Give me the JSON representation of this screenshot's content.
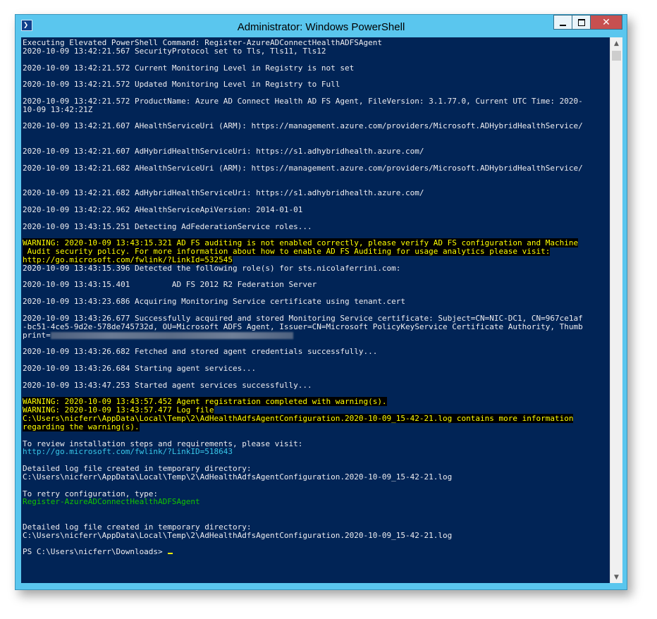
{
  "window": {
    "title": "Administrator: Windows PowerShell",
    "icon": "powershell-icon",
    "icon_glyph": "❯",
    "controls": {
      "minimize": "minimize-icon",
      "maximize": "maximize-icon",
      "close_glyph": "✕"
    }
  },
  "colors": {
    "console_bg": "#012456",
    "text": "#eeedf0",
    "warning_fg": "#ffff00",
    "warning_bg": "#000000",
    "link": "#38c7e8",
    "command": "#13c400"
  },
  "console": {
    "lines": [
      {
        "text": "Executing Elevated PowerShell Command: Register-AzureADConnectHealthADFSAgent",
        "style": "normal"
      },
      {
        "text": "2020-10-09 13:42:21.567 SecurityProtocol set to Tls, Tls11, Tls12",
        "style": "normal"
      },
      {
        "text": "",
        "style": "normal"
      },
      {
        "text": "2020-10-09 13:42:21.572 Current Monitoring Level in Registry is not set",
        "style": "normal"
      },
      {
        "text": "",
        "style": "normal"
      },
      {
        "text": "2020-10-09 13:42:21.572 Updated Monitoring Level in Registry to Full",
        "style": "normal"
      },
      {
        "text": "",
        "style": "normal"
      },
      {
        "text": "2020-10-09 13:42:21.572 ProductName: Azure AD Connect Health AD FS Agent, FileVersion: 3.1.77.0, Current UTC Time: 2020-",
        "style": "normal"
      },
      {
        "text": "10-09 13:42:21Z",
        "style": "normal"
      },
      {
        "text": "",
        "style": "normal"
      },
      {
        "text": "2020-10-09 13:42:21.607 AHealthServiceUri (ARM): https://management.azure.com/providers/Microsoft.ADHybridHealthService/",
        "style": "normal"
      },
      {
        "text": "",
        "style": "normal"
      },
      {
        "text": "",
        "style": "normal"
      },
      {
        "text": "2020-10-09 13:42:21.607 AdHybridHealthServiceUri: https://s1.adhybridhealth.azure.com/",
        "style": "normal"
      },
      {
        "text": "",
        "style": "normal"
      },
      {
        "text": "2020-10-09 13:42:21.682 AHealthServiceUri (ARM): https://management.azure.com/providers/Microsoft.ADHybridHealthService/",
        "style": "normal"
      },
      {
        "text": "",
        "style": "normal"
      },
      {
        "text": "",
        "style": "normal"
      },
      {
        "text": "2020-10-09 13:42:21.682 AdHybridHealthServiceUri: https://s1.adhybridhealth.azure.com/",
        "style": "normal"
      },
      {
        "text": "",
        "style": "normal"
      },
      {
        "text": "2020-10-09 13:42:22.962 AHealthServiceApiVersion: 2014-01-01",
        "style": "normal"
      },
      {
        "text": "",
        "style": "normal"
      },
      {
        "text": "2020-10-09 13:43:15.251 Detecting AdFederationService roles...",
        "style": "normal"
      },
      {
        "text": "",
        "style": "normal"
      },
      {
        "text": "WARNING: 2020-10-09 13:43:15.321 AD FS auditing is not enabled correctly, please verify AD FS configuration and Machine",
        "style": "warn"
      },
      {
        "text": " Audit security policy. For more information about how to enable AD FS Auditing for usage analytics please visit:",
        "style": "warn"
      },
      {
        "text": "http://go.microsoft.com/fwlink/?LinkId=532545",
        "style": "warn"
      },
      {
        "text": "2020-10-09 13:43:15.396 Detected the following role(s) for sts.nicolaferrini.com:",
        "style": "normal"
      },
      {
        "text": "",
        "style": "normal"
      },
      {
        "text": "2020-10-09 13:43:15.401         AD FS 2012 R2 Federation Server",
        "style": "normal"
      },
      {
        "text": "",
        "style": "normal"
      },
      {
        "text": "2020-10-09 13:43:23.686 Acquiring Monitoring Service certificate using tenant.cert",
        "style": "normal"
      },
      {
        "text": "",
        "style": "normal"
      },
      {
        "text": "2020-10-09 13:43:26.677 Successfully acquired and stored Monitoring Service certificate: Subject=CN=NIC-DC1, CN=967ce1af",
        "style": "normal"
      },
      {
        "text": "-bc51-4ce5-9d2e-578de745732d, OU=Microsoft ADFS Agent, Issuer=CN=Microsoft PolicyKeyService Certificate Authority, Thumb",
        "style": "normal"
      },
      {
        "text": "print=",
        "style": "blurred",
        "blur_width": "52ch"
      },
      {
        "text": "",
        "style": "normal"
      },
      {
        "text": "2020-10-09 13:43:26.682 Fetched and stored agent credentials successfully...",
        "style": "normal"
      },
      {
        "text": "",
        "style": "normal"
      },
      {
        "text": "2020-10-09 13:43:26.684 Starting agent services...",
        "style": "normal"
      },
      {
        "text": "",
        "style": "normal"
      },
      {
        "text": "2020-10-09 13:43:47.253 Started agent services successfully...",
        "style": "normal"
      },
      {
        "text": "",
        "style": "normal"
      },
      {
        "text": "WARNING: 2020-10-09 13:43:57.452 Agent registration completed with warning(s).",
        "style": "warn"
      },
      {
        "text": "WARNING: 2020-10-09 13:43:57.477 Log file",
        "style": "warn"
      },
      {
        "text": "C:\\Users\\nicferr\\AppData\\Local\\Temp\\2\\AdHealthAdfsAgentConfiguration.2020-10-09_15-42-21.log contains more information",
        "style": "warn"
      },
      {
        "text": "regarding the warning(s).",
        "style": "warn"
      },
      {
        "text": "",
        "style": "normal"
      },
      {
        "text": "To review installation steps and requirements, please visit:",
        "style": "normal"
      },
      {
        "text": "http://go.microsoft.com/fwlink/?LinkID=518643",
        "style": "link"
      },
      {
        "text": "",
        "style": "normal"
      },
      {
        "text": "Detailed log file created in temporary directory:",
        "style": "normal"
      },
      {
        "text": "C:\\Users\\nicferr\\AppData\\Local\\Temp\\2\\AdHealthAdfsAgentConfiguration.2020-10-09_15-42-21.log",
        "style": "normal"
      },
      {
        "text": "",
        "style": "normal"
      },
      {
        "text": "To retry configuration, type:",
        "style": "normal"
      },
      {
        "text": "Register-AzureADConnectHealthADFSAgent",
        "style": "green"
      },
      {
        "text": "",
        "style": "normal"
      },
      {
        "text": "",
        "style": "normal"
      },
      {
        "text": "Detailed log file created in temporary directory:",
        "style": "normal"
      },
      {
        "text": "C:\\Users\\nicferr\\AppData\\Local\\Temp\\2\\AdHealthAdfsAgentConfiguration.2020-10-09_15-42-21.log",
        "style": "normal"
      },
      {
        "text": "",
        "style": "normal"
      },
      {
        "text": "PS C:\\Users\\nicferr\\Downloads> ",
        "style": "prompt"
      }
    ]
  },
  "scrollbar": {
    "up_glyph": "▲",
    "down_glyph": "▼"
  }
}
